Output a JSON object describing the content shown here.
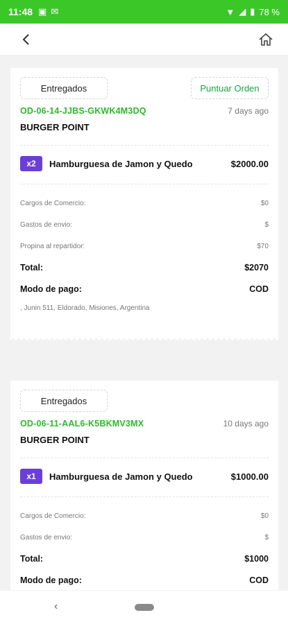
{
  "status_bar": {
    "time": "11:48",
    "battery": "78 %"
  },
  "orders": [
    {
      "status_label": "Entregados",
      "rate_label": "Puntuar Orden",
      "order_id": "OD-06-14-JJBS-GKWK4M3DQ",
      "time_ago": "7 days ago",
      "store": "BURGER POINT",
      "item": {
        "qty": "x2",
        "name": "Hamburguesa de Jamon y Quedo",
        "price": "$2000.00"
      },
      "fees": [
        {
          "label": "Cargos de Comercio:",
          "value": "$0"
        },
        {
          "label": "Gastos de envio:",
          "value": "$"
        },
        {
          "label": "Propina al repartidor:",
          "value": "$70"
        }
      ],
      "total_label": "Total:",
      "total_value": "$2070",
      "payment_label": "Modo de pago:",
      "payment_value": "COD",
      "address": ", Junin 511, Eldorado, Misiones, Argentina"
    },
    {
      "status_label": "Entregados",
      "order_id": "OD-06-11-AAL6-K5BKMV3MX",
      "time_ago": "10 days ago",
      "store": "BURGER POINT",
      "item": {
        "qty": "x1",
        "name": "Hamburguesa de Jamon y Quedo",
        "price": "$1000.00"
      },
      "fees": [
        {
          "label": "Cargos de Comercio:",
          "value": "$0"
        },
        {
          "label": "Gastos de envio:",
          "value": "$"
        }
      ],
      "total_label": "Total:",
      "total_value": "$1000",
      "payment_label": "Modo de pago:",
      "payment_value": "COD"
    }
  ],
  "icons": {
    "back": "back-arrow-icon",
    "home": "home-icon"
  },
  "colors": {
    "status_bar": "#3cc729",
    "order_id": "#2db82d",
    "qty_badge": "#6a3fd8",
    "rate_text": "#16a34a"
  }
}
